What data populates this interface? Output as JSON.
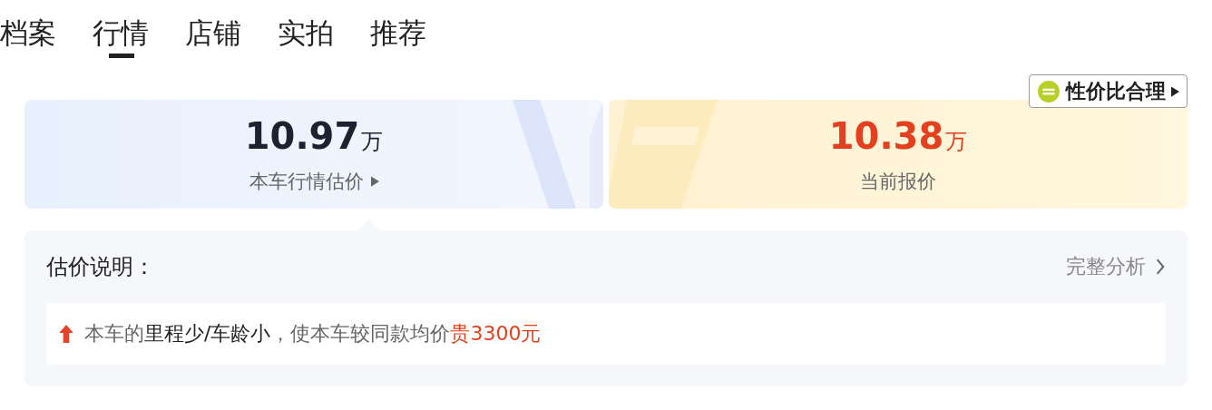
{
  "tabs": [
    {
      "label": "档案",
      "selected": false
    },
    {
      "label": "行情",
      "selected": true
    },
    {
      "label": "店铺",
      "selected": false
    },
    {
      "label": "实拍",
      "selected": false
    },
    {
      "label": "推荐",
      "selected": false
    }
  ],
  "badge": {
    "label": "性价比合理"
  },
  "prices": [
    {
      "kind": "estimate",
      "value": "10.97",
      "unit": "万",
      "label": "本车行情估价",
      "has_arrow": true
    },
    {
      "kind": "quote",
      "value": "10.38",
      "unit": "万",
      "label": "当前报价",
      "has_arrow": false
    }
  ],
  "explanation": {
    "title": "估价说明：",
    "link": "完整分析",
    "note": {
      "rising": true,
      "segments": [
        {
          "kind": "muted",
          "text": "本车的"
        },
        {
          "kind": "strong",
          "text": "里程少/车龄小"
        },
        {
          "kind": "muted",
          "text": "，使本车较同款均价"
        },
        {
          "kind": "accent",
          "text": "贵3300元"
        }
      ]
    }
  }
}
